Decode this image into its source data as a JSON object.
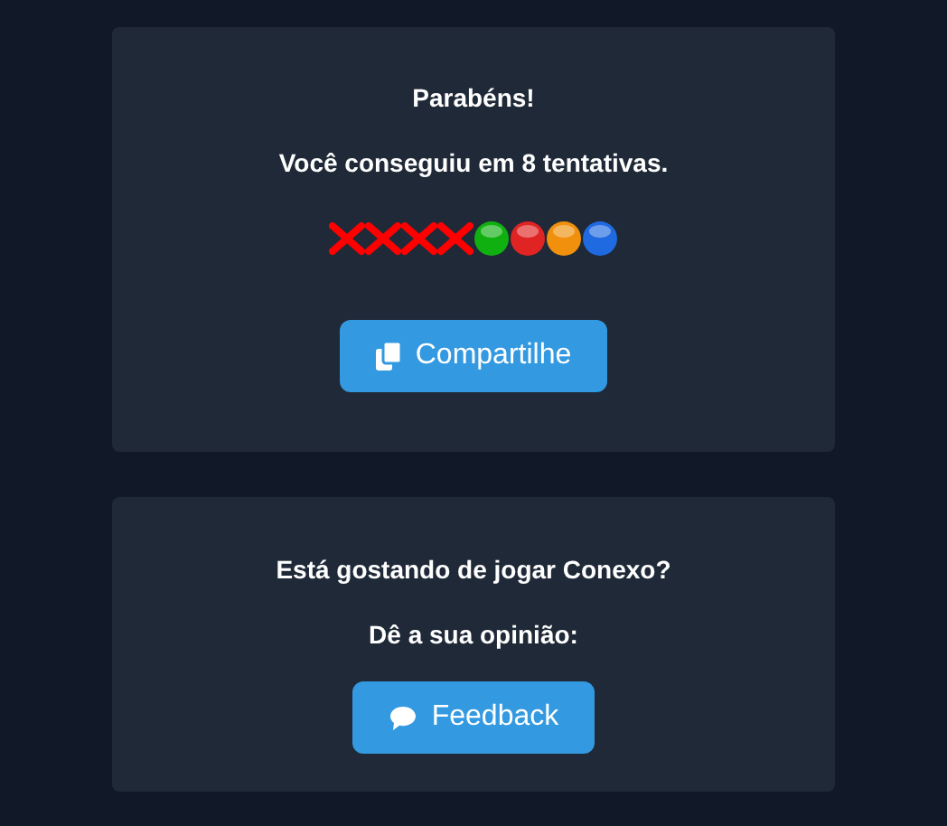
{
  "result_card": {
    "title": "Parabéns!",
    "message": "Você conseguiu em 8 tentativas.",
    "attempts": [
      {
        "kind": "miss"
      },
      {
        "kind": "miss"
      },
      {
        "kind": "miss"
      },
      {
        "kind": "miss"
      },
      {
        "kind": "hit",
        "color": "#11b011"
      },
      {
        "kind": "hit",
        "color": "#e02424"
      },
      {
        "kind": "hit",
        "color": "#f0900c"
      },
      {
        "kind": "hit",
        "color": "#1f6ae0"
      }
    ],
    "share_button": "Compartilhe"
  },
  "feedback_card": {
    "question": "Está gostando de jogar Conexo?",
    "prompt": "Dê a sua opinião:",
    "feedback_button": "Feedback"
  }
}
